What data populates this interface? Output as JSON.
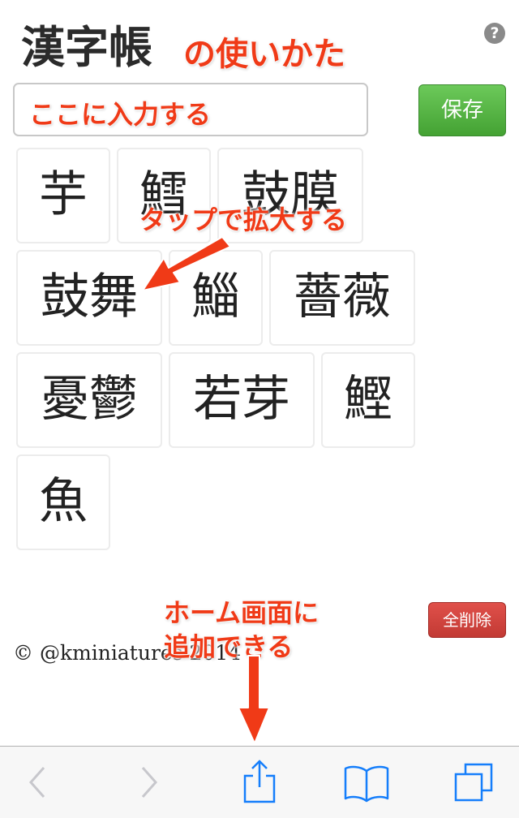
{
  "header": {
    "title": "漢字帳",
    "help_icon": "?"
  },
  "search": {
    "value": "",
    "placeholder": ""
  },
  "toolbar_main": {
    "save_label": "保存",
    "delete_all_label": "全削除"
  },
  "tiles": [
    "芋",
    "鱈",
    "鼓膜",
    "鼓舞",
    "鯔",
    "薔薇",
    "憂鬱",
    "若芽",
    "鰹",
    "魚"
  ],
  "footer": {
    "copyright": "© @kminiatures 2014"
  },
  "annotations": {
    "title_suffix": "の使いかた",
    "input_hint": "ここに入力する",
    "tap_hint": "タップで拡大する",
    "home_hint_line1": "ホーム画面に",
    "home_hint_line2": "追加できる"
  },
  "colors": {
    "annotation": "#f03a17",
    "save_button": "#4aa83a",
    "delete_button": "#c9403a",
    "toolbar_icon_active": "#157efb",
    "toolbar_icon_disabled": "#c7c7cc"
  },
  "browser_toolbar": {
    "icons": [
      "back-icon",
      "forward-icon",
      "share-icon",
      "bookmarks-icon",
      "tabs-icon"
    ]
  }
}
